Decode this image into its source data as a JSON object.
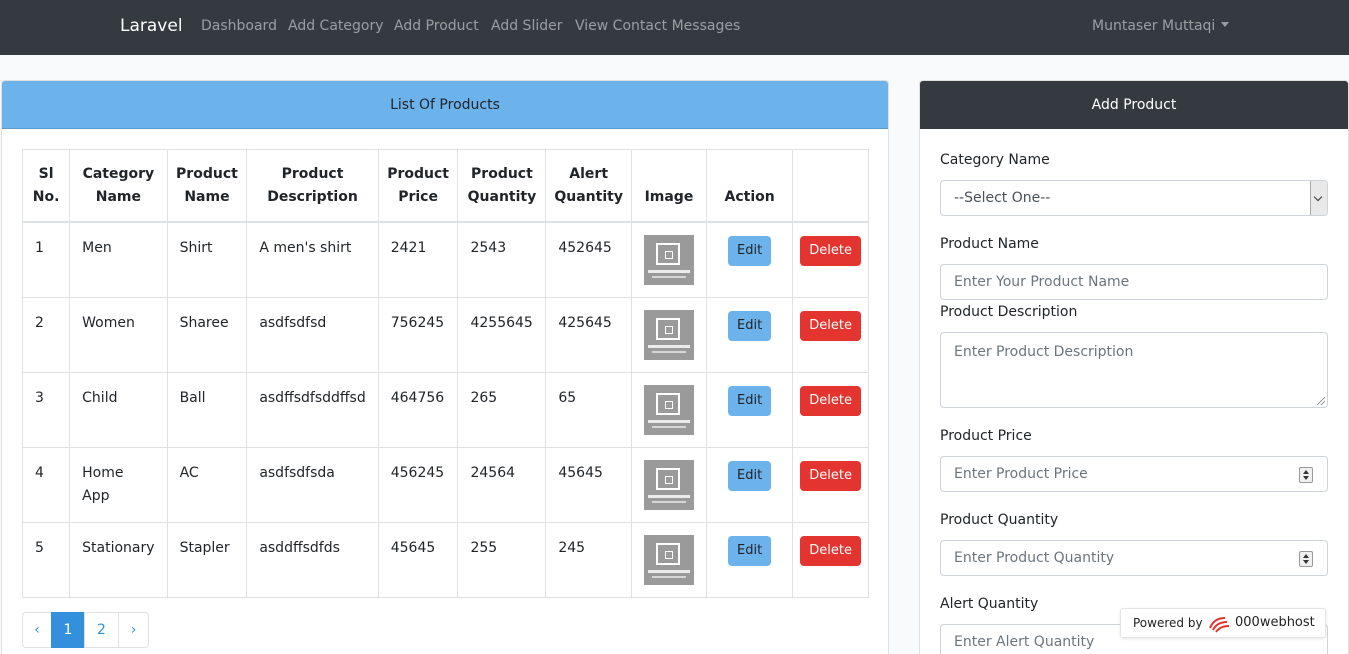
{
  "navbar": {
    "brand": "Laravel",
    "links": [
      "Dashboard",
      "Add Category",
      "Add Product",
      "Add Slider",
      "View Contact Messages"
    ],
    "user": "Muntaser Muttaqi"
  },
  "products_card": {
    "title": "List Of Products",
    "columns": [
      "Sl No.",
      "Category Name",
      "Product Name",
      "Product Description",
      "Product Price",
      "Product Quantity",
      "Alert Quantity",
      "Image",
      "Action",
      ""
    ],
    "rows": [
      {
        "sl": "1",
        "category": "Men",
        "name": "Shirt",
        "description": "A men's shirt",
        "price": "2421",
        "quantity": "2543",
        "alert": "452645"
      },
      {
        "sl": "2",
        "category": "Women",
        "name": "Sharee",
        "description": "asdfsdfsd",
        "price": "756245",
        "quantity": "4255645",
        "alert": "425645"
      },
      {
        "sl": "3",
        "category": "Child",
        "name": "Ball",
        "description": "asdffsdfsddffsd",
        "price": "464756",
        "quantity": "265",
        "alert": "65"
      },
      {
        "sl": "4",
        "category": "Home App",
        "name": "AC",
        "description": "asdfsdfsda",
        "price": "456245",
        "quantity": "24564",
        "alert": "45645"
      },
      {
        "sl": "5",
        "category": "Stationary",
        "name": "Stapler",
        "description": "asddffsdfds",
        "price": "45645",
        "quantity": "255",
        "alert": "245"
      }
    ],
    "edit_label": "Edit",
    "delete_label": "Delete",
    "pagination": {
      "prev": "‹",
      "pages": [
        "1",
        "2"
      ],
      "active": "1",
      "next": "›"
    }
  },
  "add_product": {
    "title": "Add Product",
    "category_label": "Category Name",
    "category_value": "--Select One--",
    "name_label": "Product Name",
    "name_placeholder": "Enter Your Product Name",
    "description_label": "Product Description",
    "description_placeholder": "Enter Product Description",
    "price_label": "Product Price",
    "price_placeholder": "Enter Product Price",
    "quantity_label": "Product Quantity",
    "quantity_placeholder": "Enter Product Quantity",
    "alert_label": "Alert Quantity",
    "alert_placeholder": "Enter Alert Quantity"
  },
  "badge": {
    "powered_by": "Powered by",
    "host": "000webhost"
  },
  "colors": {
    "navbar": "#343a40",
    "info": "#6cb2eb",
    "danger": "#e3342f",
    "primary": "#3490dc"
  }
}
